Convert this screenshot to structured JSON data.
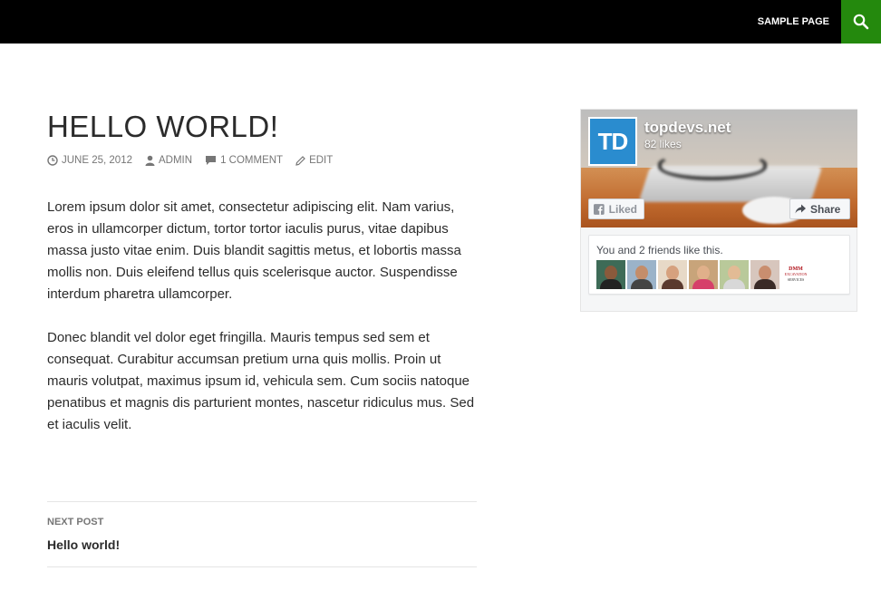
{
  "header": {
    "nav_items": [
      {
        "label": "SAMPLE PAGE"
      }
    ],
    "search_icon": "search-icon",
    "accent_color": "#24890d",
    "bar_color": "#000000"
  },
  "post": {
    "title": "HELLO WORLD!",
    "meta": {
      "date": "JUNE 25, 2012",
      "author": "ADMIN",
      "comments": "1 COMMENT",
      "edit": "EDIT"
    },
    "paragraphs": [
      "Lorem ipsum dolor sit amet, consectetur adipiscing elit. Nam varius, eros in ullamcorper dictum, tortor tortor iaculis purus, vitae dapibus massa justo vitae enim. Duis blandit sagittis metus, et lobortis massa mollis non. Duis eleifend tellus quis scelerisque auctor. Suspendisse interdum pharetra ullamcorper.",
      "Donec blandit vel dolor eget fringilla. Mauris tempus sed sem et consequat. Curabitur accumsan pretium urna quis mollis. Proin ut mauris volutpat, maximus ipsum id, vehicula sem. Cum sociis natoque penatibus et magnis dis parturient montes, nascetur ridiculus mus. Sed et iaculis velit."
    ]
  },
  "post_navigation": {
    "kicker": "NEXT POST",
    "title": "Hello world!"
  },
  "facebook_widget": {
    "page_name": "topdevs.net",
    "likes": "82 likes",
    "avatar_text": "TD",
    "liked_label": "Liked",
    "share_label": "Share",
    "friends_text": "You and 2 friends like this.",
    "logo_face": {
      "line1": "DMM",
      "line2": "EXCAVATION",
      "line3": "SERVICES"
    },
    "brand_color": "#2a8ccf"
  }
}
